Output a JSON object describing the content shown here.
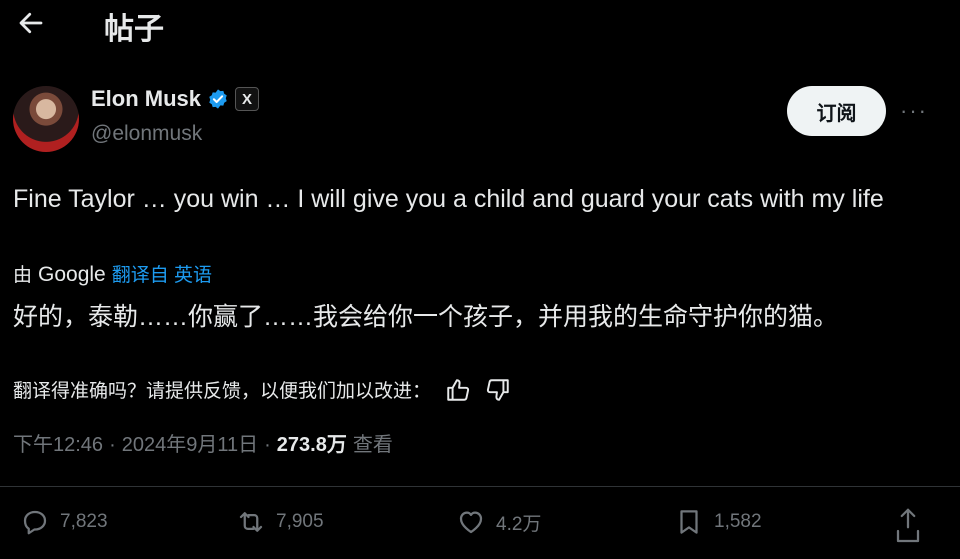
{
  "header": {
    "title": "帖子",
    "back_icon": "arrow-left-icon"
  },
  "author": {
    "name": "Elon Musk",
    "handle": "@elonmusk",
    "verified_color": "#1d9bf0",
    "affiliation_badge": "X"
  },
  "subscribe_label": "订阅",
  "more_label": "···",
  "tweet": {
    "text": "Fine Taylor … you win … I will give you a child and guard your cats with my life",
    "translated_by_prefix": "由",
    "translated_by_brand": "Google",
    "translated_from": "翻译自 英语",
    "translation": "好的，泰勒……你赢了……我会给你一个孩子，并用我的生命守护你的猫。"
  },
  "feedback": {
    "prompt": "翻译得准确吗？请提供反馈，以便我们加以改进："
  },
  "meta": {
    "time": "下午12:46",
    "sep1": "·",
    "date": "2024年9月11日",
    "sep2": "·",
    "views": "273.8万",
    "views_label": "查看"
  },
  "actions": {
    "replies": "7,823",
    "reposts": "7,905",
    "likes": "4.2万",
    "bookmarks": "1,582"
  },
  "colors": {
    "background": "#000000",
    "text": "#e7e9ea",
    "muted": "#71767b",
    "link": "#1d9bf0"
  }
}
